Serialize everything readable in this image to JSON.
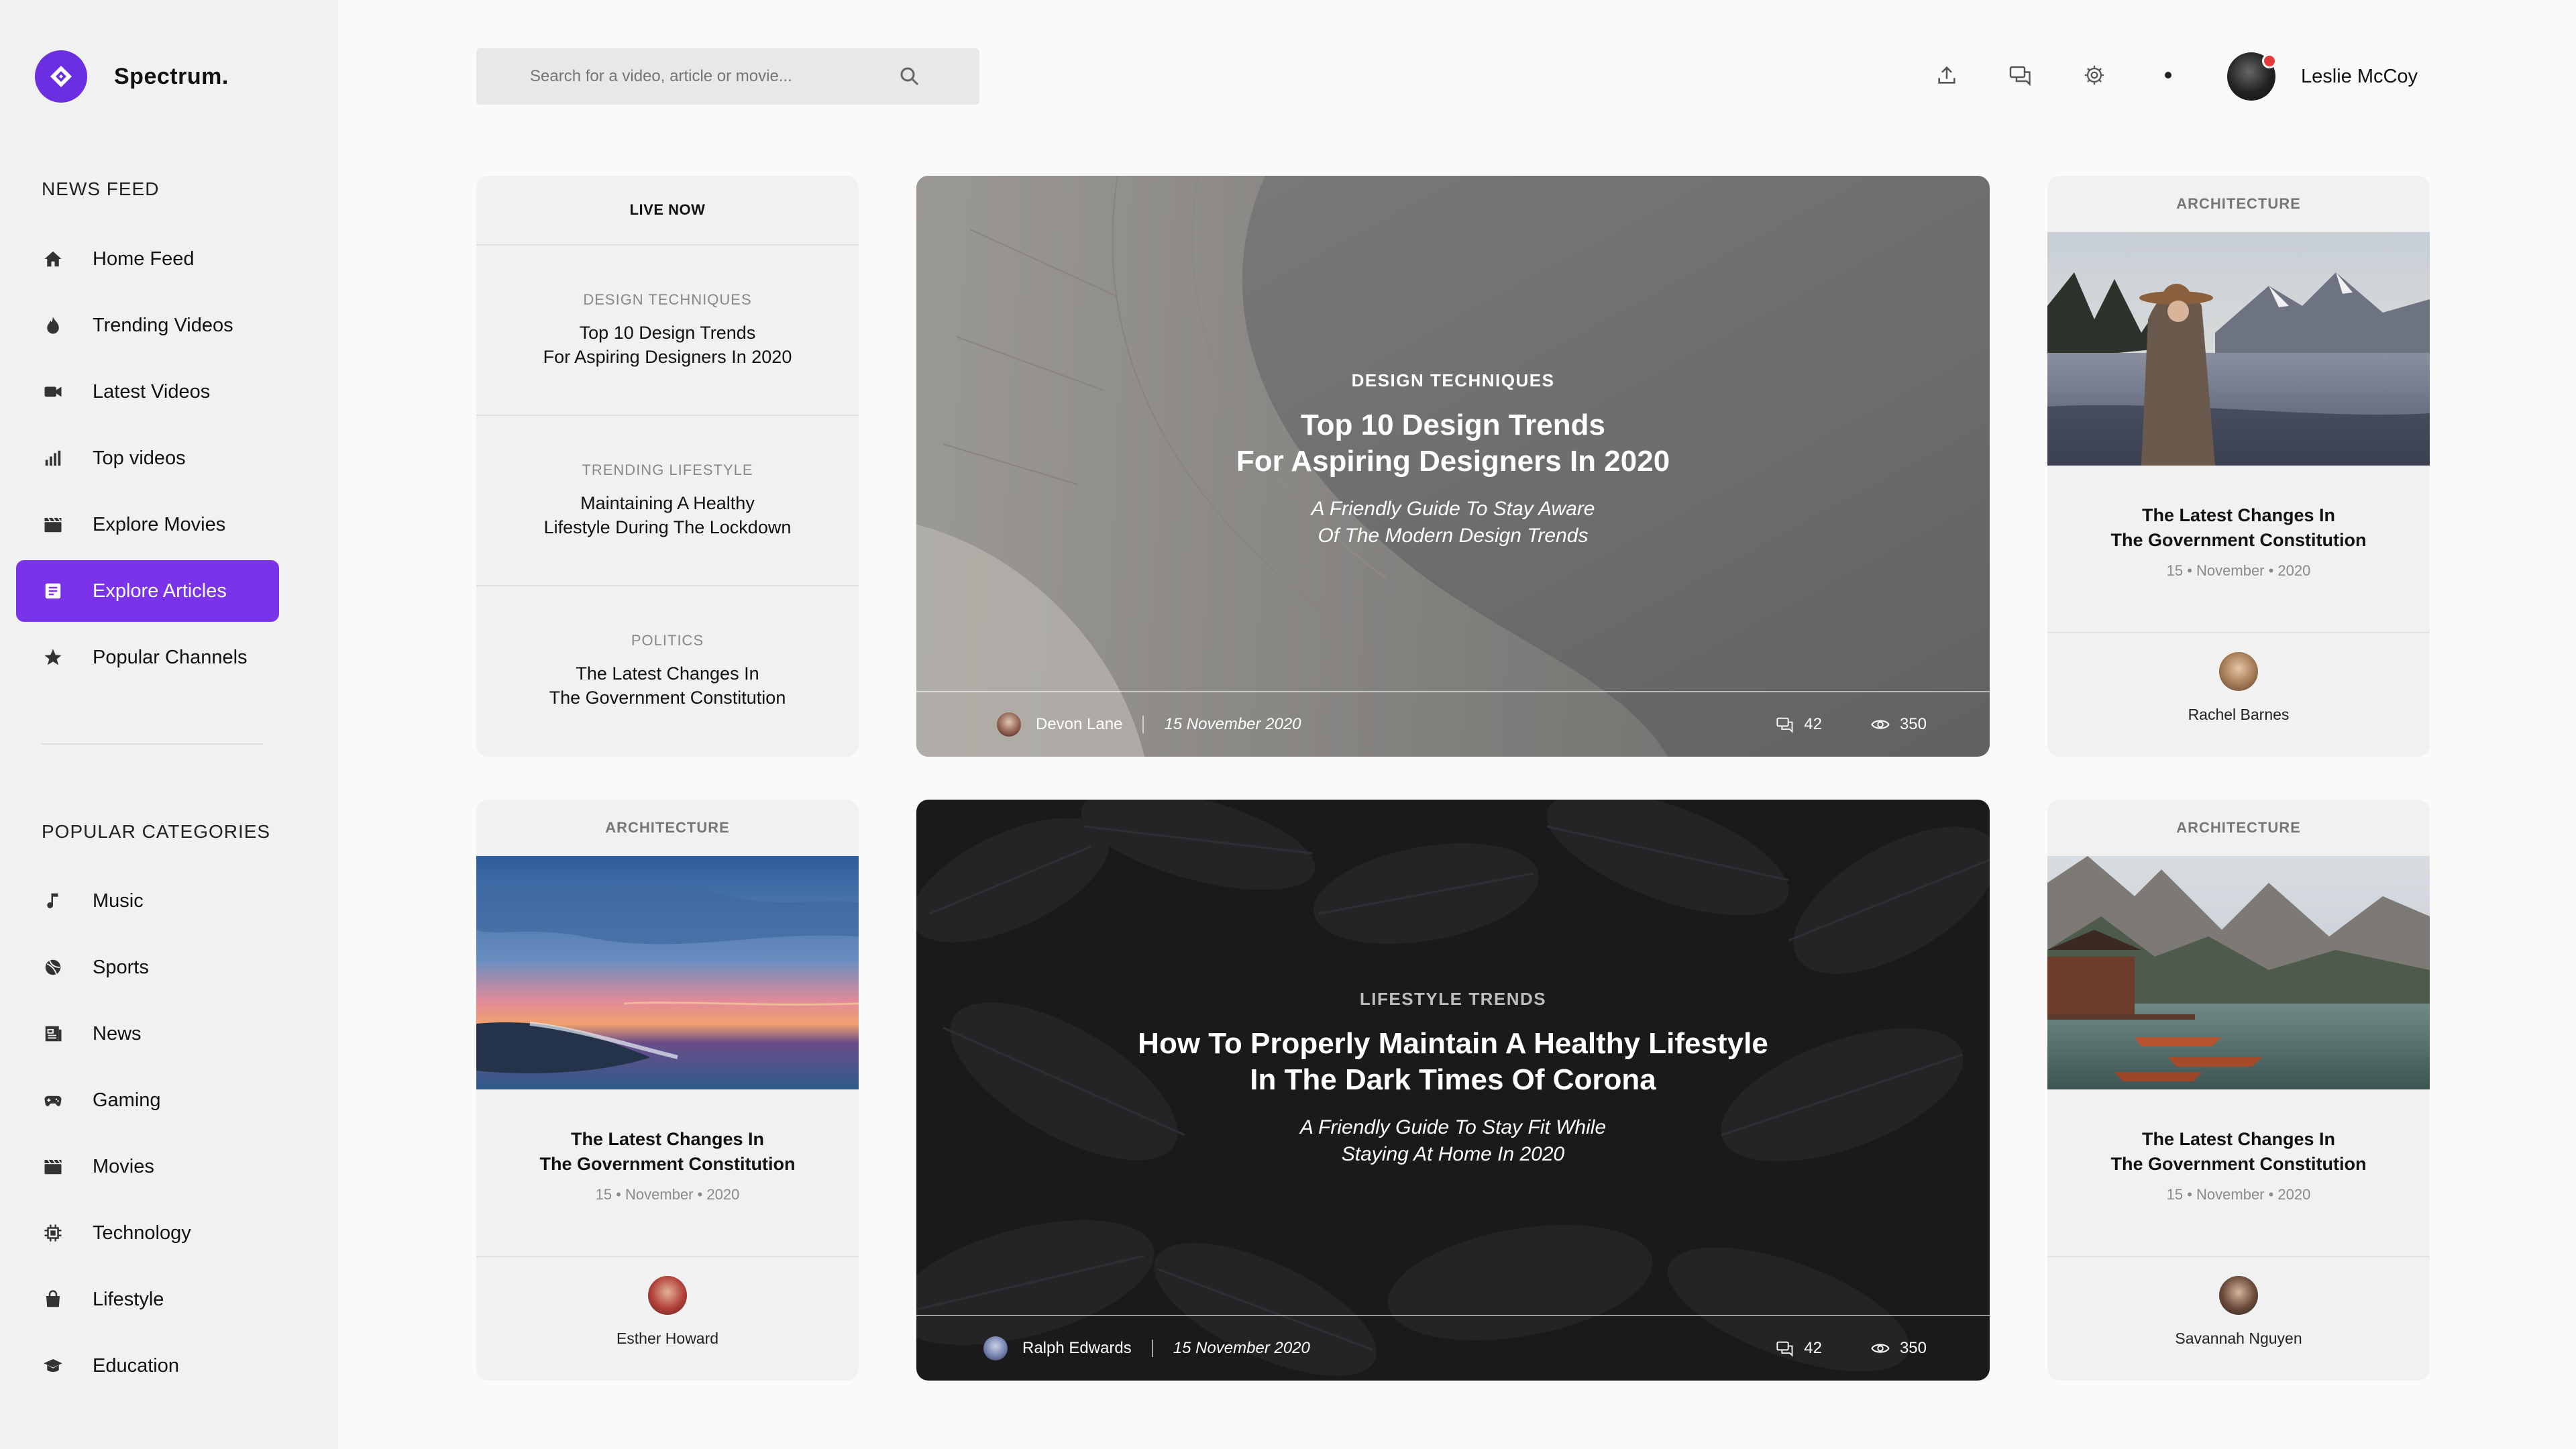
{
  "brand": {
    "name": "Spectrum."
  },
  "sidebar": {
    "news_feed_title": "NEWS FEED",
    "items": [
      {
        "label": "Home Feed",
        "icon": "home-icon"
      },
      {
        "label": "Trending Videos",
        "icon": "fire-icon"
      },
      {
        "label": "Latest Videos",
        "icon": "video-camera-icon"
      },
      {
        "label": "Top videos",
        "icon": "bar-chart-icon"
      },
      {
        "label": "Explore Movies",
        "icon": "clapperboard-icon"
      },
      {
        "label": "Explore Articles",
        "icon": "article-icon",
        "active": true
      },
      {
        "label": "Popular Channels",
        "icon": "star-icon"
      }
    ],
    "categories_title": "POPULAR CATEGORIES",
    "categories": [
      {
        "label": "Music",
        "icon": "music-note-icon"
      },
      {
        "label": "Sports",
        "icon": "ball-icon"
      },
      {
        "label": "News",
        "icon": "newspaper-icon"
      },
      {
        "label": "Gaming",
        "icon": "gamepad-icon"
      },
      {
        "label": "Movies",
        "icon": "clapperboard-icon"
      },
      {
        "label": "Technology",
        "icon": "chip-icon"
      },
      {
        "label": "Lifestyle",
        "icon": "bag-icon"
      },
      {
        "label": "Education",
        "icon": "graduation-cap-icon"
      }
    ]
  },
  "header": {
    "search_placeholder": "Search for a video, article or movie...",
    "icons": [
      "upload-icon",
      "chat-icon",
      "settings-icon",
      "dot-icon"
    ],
    "user_name": "Leslie McCoy"
  },
  "live": {
    "title": "LIVE NOW",
    "items": [
      {
        "category": "DESIGN TECHNIQUES",
        "title_1": "Top 10 Design Trends",
        "title_2": "For Aspiring Designers In 2020"
      },
      {
        "category": "TRENDING LIFESTYLE",
        "title_1": "Maintaining A Healthy",
        "title_2": "Lifestyle During The Lockdown"
      },
      {
        "category": "POLITICS",
        "title_1": "The Latest Changes In",
        "title_2": "The Government Constitution"
      }
    ]
  },
  "hero_top": {
    "category": "DESIGN TECHNIQUES",
    "title_1": "Top 10 Design Trends",
    "title_2": "For Aspiring Designers In 2020",
    "sub_1": "A Friendly Guide To Stay Aware",
    "sub_2": "Of The Modern Design Trends",
    "author": "Devon Lane",
    "date": "15 November 2020",
    "comments": "42",
    "views": "350"
  },
  "hero_bottom": {
    "category": "LIFESTYLE TRENDS",
    "title_1": "How To Properly Maintain A Healthy Lifestyle",
    "title_2": "In The Dark Times Of Corona",
    "sub_1": "A Friendly Guide To Stay Fit While",
    "sub_2": "Staying At Home In 2020",
    "author": "Ralph Edwards",
    "date": "15 November 2020",
    "comments": "42",
    "views": "350"
  },
  "cards": {
    "top_right": {
      "category": "ARCHITECTURE",
      "title_1": "The Latest Changes In",
      "title_2": "The Government Constitution",
      "date": "15 • November • 2020",
      "author": "Rachel Barnes"
    },
    "bottom_left": {
      "category": "ARCHITECTURE",
      "title_1": "The Latest Changes In",
      "title_2": "The Government Constitution",
      "date": "15 • November • 2020",
      "author": "Esther Howard"
    },
    "bottom_right": {
      "category": "ARCHITECTURE",
      "title_1": "The Latest Changes In",
      "title_2": "The Government Constitution",
      "date": "15 • November • 2020",
      "author": "Savannah Nguyen"
    }
  },
  "colors": {
    "accent": "#7a33e8",
    "sidebar_bg": "#f1f1f1",
    "page_bg": "#fafafa"
  }
}
